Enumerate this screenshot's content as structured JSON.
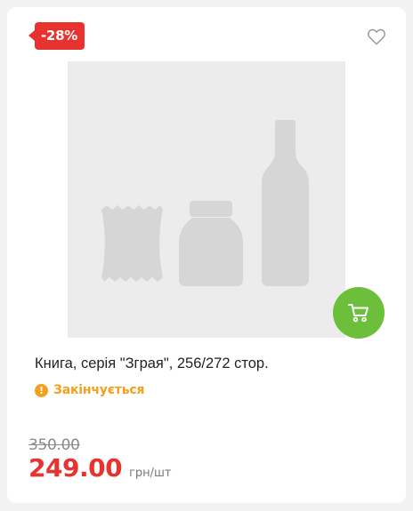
{
  "discount_badge": "-28%",
  "product": {
    "title": "Книга, серія \"Зграя\", 256/272 стор.",
    "stock_status": "Закінчується",
    "stock_icon": "!",
    "old_price": "350.00",
    "price": "249.00",
    "unit": "грн/шт"
  },
  "icons": {
    "favorite": "heart-outline-icon",
    "cart": "cart-icon",
    "stock": "exclamation-circle-icon"
  },
  "colors": {
    "accent_red": "#e8322f",
    "cart_green": "#6cbf3a",
    "warning_orange": "#f4a01c"
  }
}
